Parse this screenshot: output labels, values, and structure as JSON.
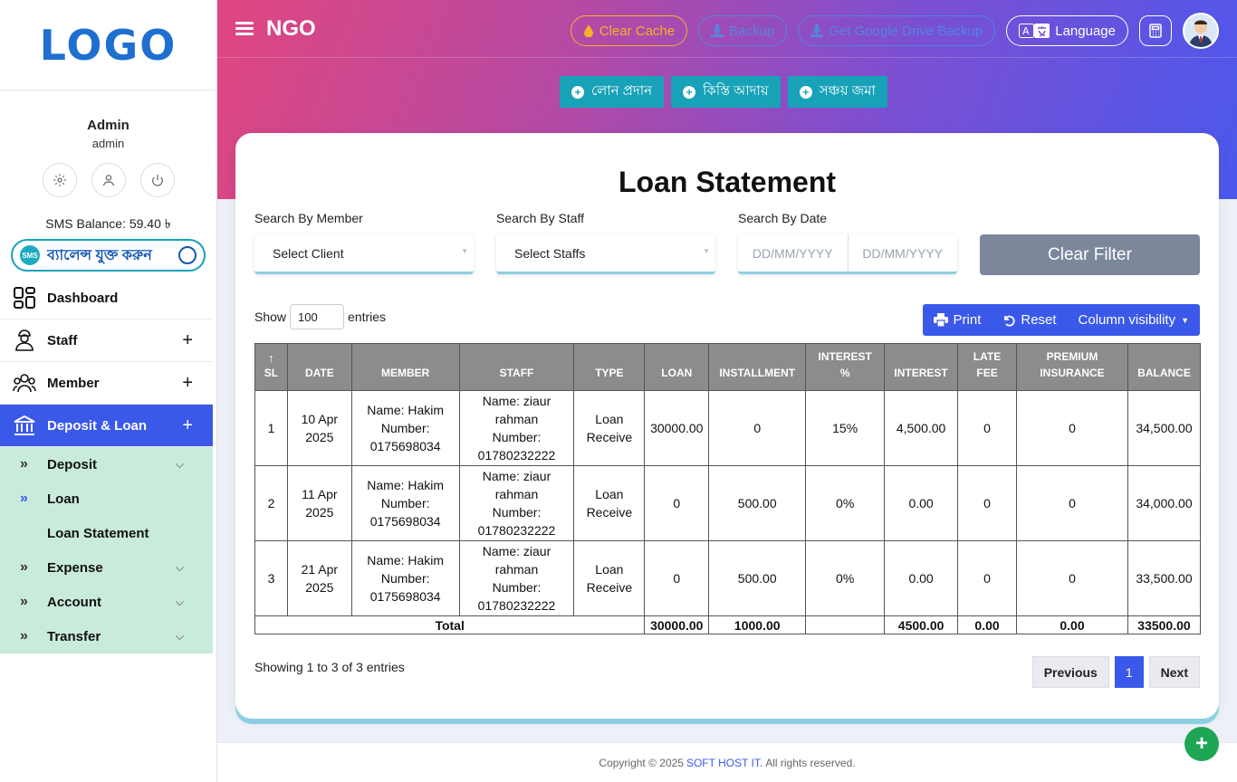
{
  "logo": {
    "text": "LOGO"
  },
  "user": {
    "name": "Admin",
    "role": "admin"
  },
  "sms": {
    "balance": "SMS Balance: 59.40 ৳",
    "add_label": "ব্যালেন্স যুক্ত করুন",
    "badge": "SMS"
  },
  "nav": {
    "dashboard": "Dashboard",
    "staff": "Staff",
    "member": "Member",
    "deposit_loan": "Deposit & Loan",
    "plus": "+"
  },
  "submenu": {
    "deposit": "Deposit",
    "loan": "Loan",
    "loan_statement": "Loan Statement",
    "expense": "Expense",
    "account": "Account",
    "transfer": "Transfer",
    "arrow": "»",
    "chevron": "⌵"
  },
  "header": {
    "brand": "NGO",
    "clear_cache": "Clear Cache",
    "backup": "Backup",
    "drive_backup": "Get Google Drive Backup",
    "language": "Language"
  },
  "quick_actions": {
    "loan_give": "লোন প্রদান",
    "installment": "কিস্তি আদায়",
    "savings": "সঞ্চয় জমা"
  },
  "page_title": "Loan Statement",
  "filters": {
    "member_label": "Search By Member",
    "member_value": "Select Client",
    "staff_label": "Search By Staff",
    "staff_value": "Select Staffs",
    "date_label": "Search By Date",
    "date_from_placeholder": "DD/MM/YYYY",
    "date_to_placeholder": "DD/MM/YYYY",
    "clear": "Clear Filter"
  },
  "table_controls": {
    "show": "Show",
    "entries_value": "100",
    "entries": "entries",
    "print": "Print",
    "reset": "Reset",
    "column_visibility": "Column visibility"
  },
  "table": {
    "headers": [
      "SL",
      "DATE",
      "MEMBER",
      "STAFF",
      "TYPE",
      "LOAN",
      "INSTALLMENT",
      "INTEREST %",
      "INTEREST",
      "LATE FEE",
      "PREMIUM INSURANCE",
      "BALANCE"
    ],
    "sort_glyph": "↑",
    "rows": [
      {
        "sl": "1",
        "date": "10 Apr 2025",
        "member_name": "Name: Hakim",
        "member_number_label": "Number:",
        "member_number": "0175698034",
        "staff_name": "Name: ziaur rahman",
        "staff_number_label": "Number:",
        "staff_number": "01780232222",
        "type": "Loan Receive",
        "loan": "30000.00",
        "installment": "0",
        "interest_pct": "15%",
        "interest": "4,500.00",
        "late_fee": "0",
        "premium": "0",
        "balance": "34,500.00"
      },
      {
        "sl": "2",
        "date": "11 Apr 2025",
        "member_name": "Name: Hakim",
        "member_number_label": "Number:",
        "member_number": "0175698034",
        "staff_name": "Name: ziaur rahman",
        "staff_number_label": "Number:",
        "staff_number": "01780232222",
        "type": "Loan Receive",
        "loan": "0",
        "installment": "500.00",
        "interest_pct": "0%",
        "interest": "0.00",
        "late_fee": "0",
        "premium": "0",
        "balance": "34,000.00"
      },
      {
        "sl": "3",
        "date": "21 Apr 2025",
        "member_name": "Name: Hakim",
        "member_number_label": "Number:",
        "member_number": "0175698034",
        "staff_name": "Name: ziaur rahman",
        "staff_number_label": "Number:",
        "staff_number": "01780232222",
        "type": "Loan Receive",
        "loan": "0",
        "installment": "500.00",
        "interest_pct": "0%",
        "interest": "0.00",
        "late_fee": "0",
        "premium": "0",
        "balance": "33,500.00"
      }
    ],
    "total": {
      "label": "Total",
      "loan": "30000.00",
      "installment": "1000.00",
      "interest_pct": "",
      "interest": "4500.00",
      "late_fee": "0.00",
      "premium": "0.00",
      "balance": "33500.00"
    }
  },
  "pagination": {
    "info": "Showing 1 to 3 of 3 entries",
    "previous": "Previous",
    "current": "1",
    "next": "Next"
  },
  "footer": {
    "prefix": "Copyright © 2025",
    "company": "SOFT HOST IT.",
    "suffix": "All rights reserved."
  },
  "fab": "+",
  "colors": {
    "primary": "#3b59e8",
    "teal": "#17a2b8",
    "submenu_bg": "#c9ebdc",
    "header_gray": "#8c8c8c",
    "cache": "#f7b226",
    "fab": "#1fa654"
  }
}
